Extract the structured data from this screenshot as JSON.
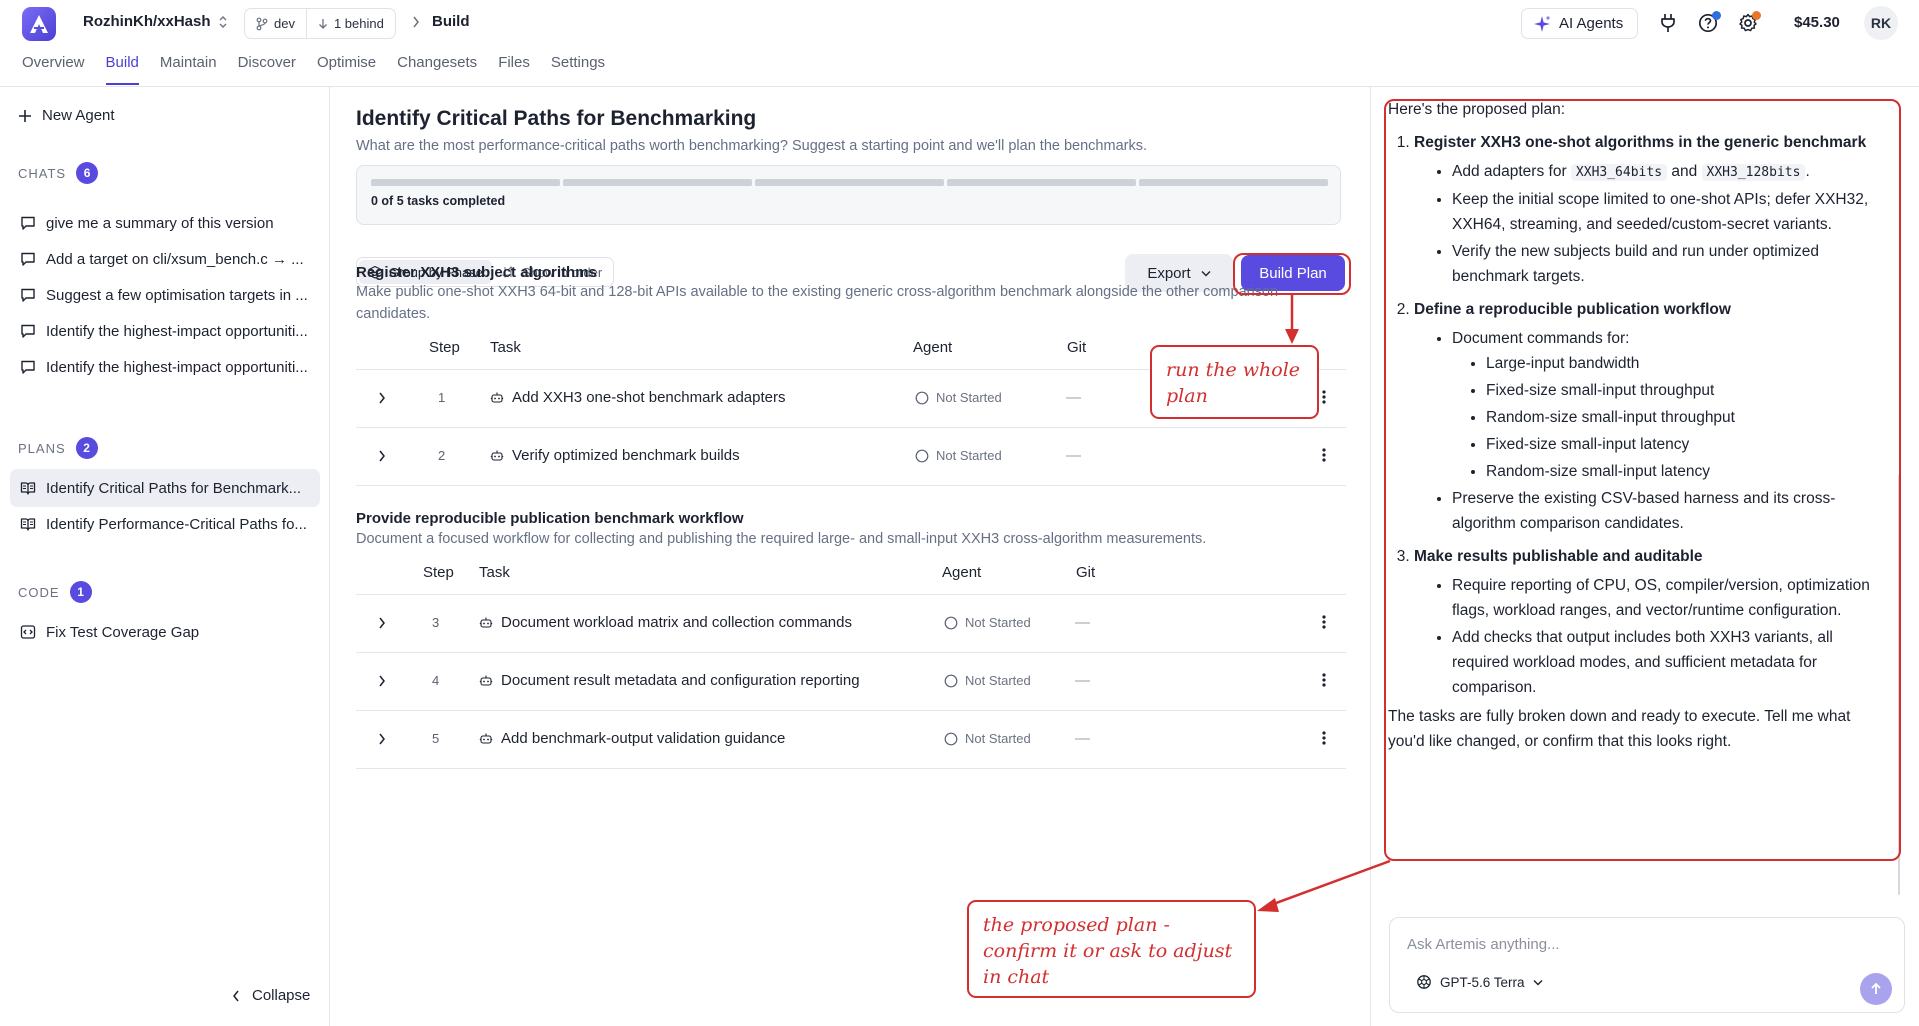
{
  "header": {
    "repo": "RozhinKh/xxHash",
    "branch": "dev",
    "behind": "1 behind",
    "breadcrumb": "Build",
    "ai_agents": "AI Agents",
    "credit": "$45.30",
    "avatar": "RK",
    "colors": {
      "accent": "#5a4be0",
      "help_dot": "#2f6fe0",
      "settings_dot": "#e8772e"
    }
  },
  "nav": {
    "tabs": [
      "Overview",
      "Build",
      "Maintain",
      "Discover",
      "Optimise",
      "Changesets",
      "Files",
      "Settings"
    ],
    "active": "Build"
  },
  "sidebar": {
    "new_agent": "New Agent",
    "chats_label": "CHATS",
    "chats_count": "6",
    "chats": [
      "give me a summary of this version",
      "Add a target on cli/xsum_bench.c → ...",
      "Suggest a few optimisation targets in ...",
      "Identify the highest-impact opportuniti...",
      "Identify the highest-impact opportuniti..."
    ],
    "plans_label": "PLANS",
    "plans_count": "2",
    "plans": [
      "Identify Critical Paths for Benchmark...",
      "Identify Performance-Critical Paths fo..."
    ],
    "code_label": "CODE",
    "code_count": "1",
    "code": [
      "Fix Test Coverage Gap"
    ],
    "collapse": "Collapse"
  },
  "plan": {
    "title": "Identify Critical Paths for Benchmarking",
    "subtitle": "What are the most performance-critical paths worth benchmarking? Suggest a starting point and we'll plan the benchmarks.",
    "progress_text": "0 of 5 tasks completed",
    "progress_completed": 0,
    "progress_total": 5,
    "group_by_phase": "Group by Phase",
    "show_in_order": "Show in order",
    "export": "Export",
    "build_plan": "Build Plan",
    "columns": {
      "step": "Step",
      "task": "Task",
      "agent": "Agent",
      "git": "Git"
    },
    "phases": [
      {
        "title": "Register XXH3 subject algorithms",
        "description": "Make public one-shot XXH3 64-bit and 128-bit APIs available to the existing generic cross-algorithm benchmark alongside the other comparison candidates.",
        "tasks": [
          {
            "step": "1",
            "task": "Add XXH3 one-shot benchmark adapters",
            "status": "Not Started",
            "git": "—"
          },
          {
            "step": "2",
            "task": "Verify optimized benchmark builds",
            "status": "Not Started",
            "git": "—"
          }
        ]
      },
      {
        "title": "Provide reproducible publication benchmark workflow",
        "description": "Document a focused workflow for collecting and publishing the required large- and small-input XXH3 cross-algorithm measurements.",
        "tasks": [
          {
            "step": "3",
            "task": "Document workload matrix and collection commands",
            "status": "Not Started",
            "git": "—"
          },
          {
            "step": "4",
            "task": "Document result metadata and configuration reporting",
            "status": "Not Started",
            "git": "—"
          },
          {
            "step": "5",
            "task": "Add benchmark-output validation guidance",
            "status": "Not Started",
            "git": "—"
          }
        ]
      }
    ]
  },
  "annotations": {
    "build_note": "run the whole plan",
    "chat_note": "the proposed plan - confirm it or ask to adjust in chat",
    "color": "#d32f2f"
  },
  "chat": {
    "intro": "Here's the proposed plan:",
    "step1_title": "Register XXH3 one-shot algorithms in the generic benchmark",
    "step1_b1_pre": "Add adapters for",
    "step1_b1_code1": "XXH3_64bits",
    "step1_b1_mid": "and",
    "step1_b1_code2": "XXH3_128bits",
    "step1_b1_post": ".",
    "step1_b2": "Keep the initial scope limited to one-shot APIs; defer XXH32, XXH64, streaming, and seeded/custom-secret variants.",
    "step1_b3": "Verify the new subjects build and run under optimized benchmark targets.",
    "step2_title": "Define a reproducible publication workflow",
    "step2_b1": "Document commands for:",
    "step2_sub": [
      "Large-input bandwidth",
      "Fixed-size small-input throughput",
      "Random-size small-input throughput",
      "Fixed-size small-input latency",
      "Random-size small-input latency"
    ],
    "step2_b2": "Preserve the existing CSV-based harness and its cross-algorithm comparison candidates.",
    "step3_title": "Make results publishable and auditable",
    "step3_b1": "Require reporting of CPU, OS, compiler/version, optimization flags, workload ranges, and vector/runtime configuration.",
    "step3_b2": "Add checks that output includes both XXH3 variants, all required workload modes, and sufficient metadata for comparison.",
    "outro": "The tasks are fully broken down and ready to execute. Tell me what you'd like changed, or confirm that this looks right.",
    "input_placeholder": "Ask Artemis anything...",
    "model": "GPT-5.6 Terra"
  }
}
